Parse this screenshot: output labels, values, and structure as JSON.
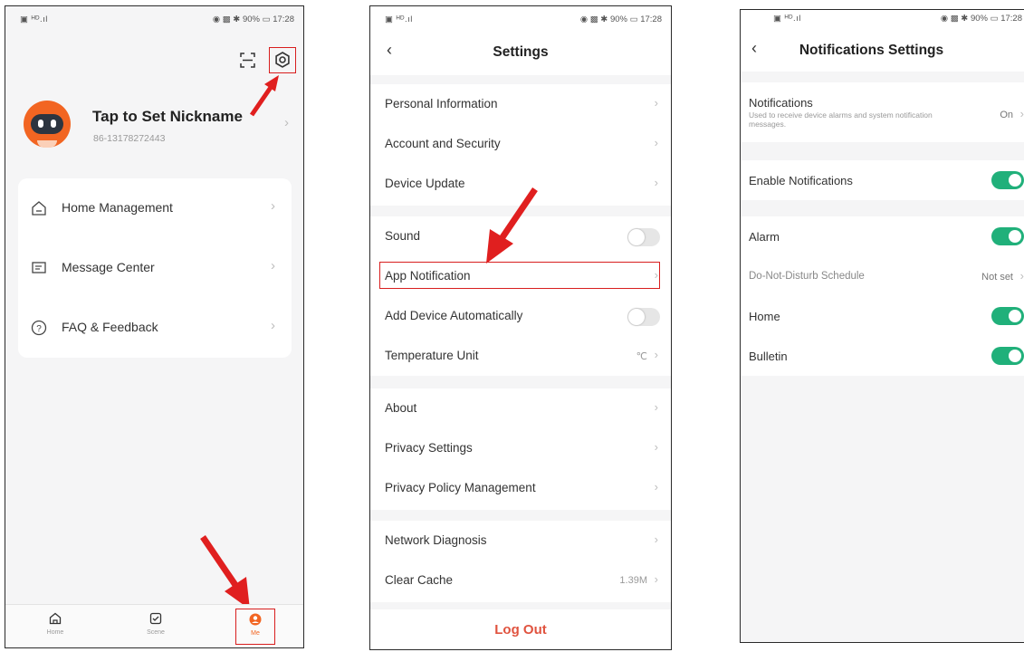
{
  "status_bar": {
    "left": "▣ ᴴᴰ.ıl",
    "right": "◉ ▩ ✱ 90% ▭ 17:28"
  },
  "me_screen": {
    "nickname": "Tap to Set Nickname",
    "phone": "86-13178272443",
    "menu": [
      {
        "label": "Home Management",
        "icon": "home-outline-icon"
      },
      {
        "label": "Message Center",
        "icon": "message-icon"
      },
      {
        "label": "FAQ & Feedback",
        "icon": "question-icon"
      }
    ],
    "tabs": [
      {
        "label": "Home",
        "icon": "home-icon"
      },
      {
        "label": "Scene",
        "icon": "scene-icon"
      },
      {
        "label": "Me",
        "icon": "person-icon"
      }
    ],
    "accent": "#f26522",
    "highlight": "#d81e1e"
  },
  "settings_screen": {
    "title": "Settings",
    "groups": [
      {
        "rows": [
          {
            "label": "Personal Information",
            "type": "link"
          },
          {
            "label": "Account and Security",
            "type": "link"
          },
          {
            "label": "Device Update",
            "type": "link"
          }
        ]
      },
      {
        "rows": [
          {
            "label": "Sound",
            "type": "toggle",
            "on": false
          },
          {
            "label": "App Notification",
            "type": "link",
            "highlighted": true
          },
          {
            "label": "Add Device Automatically",
            "type": "toggle",
            "on": false
          },
          {
            "label": "Temperature Unit",
            "type": "value",
            "value": "℃"
          }
        ]
      },
      {
        "rows": [
          {
            "label": "About",
            "type": "link"
          },
          {
            "label": "Privacy Settings",
            "type": "link"
          },
          {
            "label": "Privacy Policy Management",
            "type": "link"
          }
        ]
      },
      {
        "rows": [
          {
            "label": "Network Diagnosis",
            "type": "link"
          },
          {
            "label": "Clear Cache",
            "type": "value",
            "value": "1.39M"
          }
        ]
      }
    ],
    "logout_label": "Log Out",
    "logout_color": "#e0533f"
  },
  "notif_screen": {
    "title": "Notifications Settings",
    "notifications": {
      "label": "Notifications",
      "desc": "Used to receive device alarms and system notification messages.",
      "value": "On"
    },
    "enable_label": "Enable Notifications",
    "alarm_label": "Alarm",
    "dnd_label": "Do-Not-Disturb Schedule",
    "dnd_value": "Not set",
    "home_label": "Home",
    "bulletin_label": "Bulletin",
    "toggle_on_color": "#20b07a"
  }
}
